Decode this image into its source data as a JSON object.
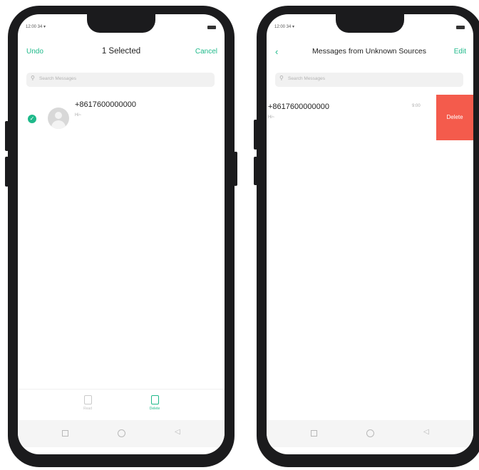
{
  "left_screen": {
    "status_time": "12:00 34 ▾",
    "topbar": {
      "undo": "Undo",
      "title": "1 Selected",
      "cancel": "Cancel"
    },
    "search_placeholder": "Search Messages",
    "message": {
      "sender": "+8617600000000",
      "snippet": "Hi~"
    },
    "bottom_actions": [
      {
        "label": "Read",
        "icon": "read-icon",
        "active": false
      },
      {
        "label": "Delete",
        "icon": "delete-icon",
        "active": true
      }
    ]
  },
  "right_screen": {
    "status_time": "12:00 34 ▾",
    "topbar": {
      "title": "Messages from Unknown Sources",
      "edit": "Edit"
    },
    "search_placeholder": "Search Messages",
    "message": {
      "sender": "+8617600000000",
      "snippet": "Hi~",
      "time": "9:00"
    },
    "swipe_action": "Delete"
  },
  "colors": {
    "accent": "#1fb98a",
    "delete": "#f45b4c",
    "device": "#1b1b1d"
  }
}
